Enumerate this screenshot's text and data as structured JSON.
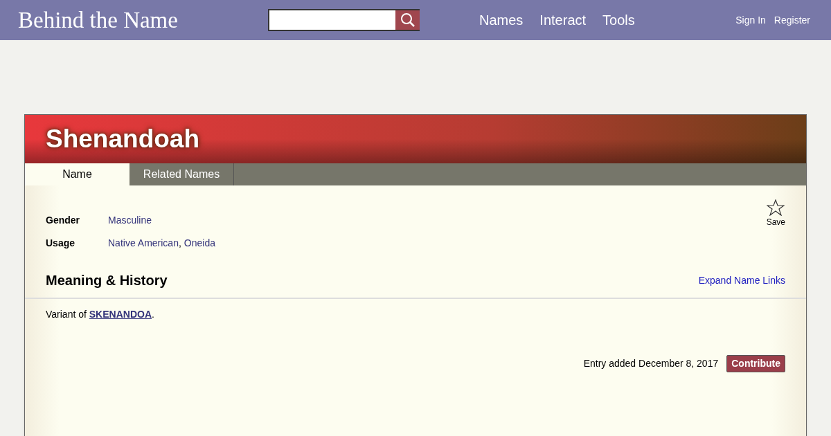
{
  "header": {
    "logo": "Behind the Name",
    "nav": [
      "Names",
      "Interact",
      "Tools"
    ],
    "account": [
      "Sign In",
      "Register"
    ]
  },
  "title": "Shenandoah",
  "tabs": [
    {
      "label": "Name",
      "selected": true
    },
    {
      "label": "Related Names",
      "selected": false
    }
  ],
  "save": {
    "label": "Save"
  },
  "info": [
    {
      "label": "Gender",
      "links": [
        "Masculine"
      ]
    },
    {
      "label": "Usage",
      "links": [
        "Native American",
        "Oneida"
      ],
      "separator": ","
    }
  ],
  "section": {
    "heading": "Meaning & History",
    "action": "Expand Name Links"
  },
  "meaning": {
    "prefix": "Variant of ",
    "link": "SKENANDOA",
    "suffix": "."
  },
  "footer": {
    "added": "Entry added December 8, 2017",
    "button": "Contribute"
  }
}
